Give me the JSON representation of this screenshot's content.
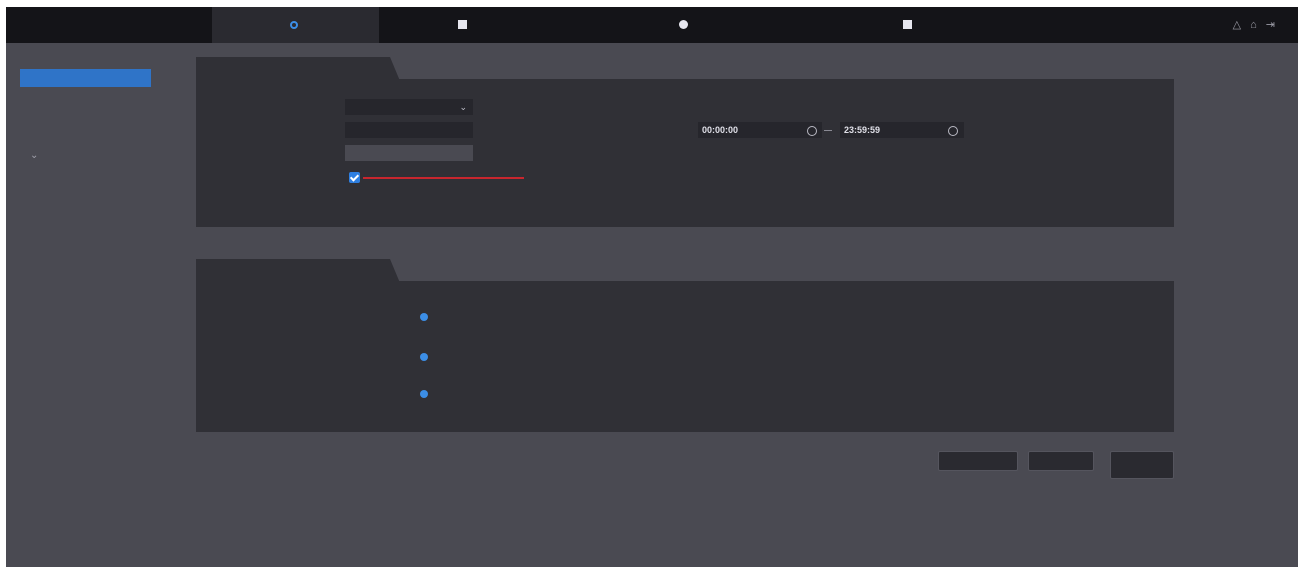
{
  "nav": {
    "home": "",
    "settings": "",
    "device_info": "",
    "network": "",
    "logs": "",
    "user": "",
    "icons": [
      "user-icon",
      "home-icon",
      "logout-icon"
    ]
  },
  "sidebar": {
    "items": [
      {
        "label": "",
        "active": true
      },
      {
        "label": "",
        "active": false
      },
      {
        "label": "",
        "active": false,
        "has_submenu": true
      },
      {
        "label": "",
        "active": false
      },
      {
        "label": "",
        "active": false
      },
      {
        "label": "",
        "active": false
      }
    ]
  },
  "device_props": {
    "tab": "",
    "device_type_label": "",
    "device_type_value": "",
    "door_number_label": "",
    "door_number_value": "",
    "max_label": "",
    "max_placeholder": "",
    "checkbox_label": "",
    "checkbox_label_2": "",
    "checkbox_checked": true,
    "schedule_label": "",
    "schedule_value": "",
    "time_range_label": "",
    "time_start": "00:00:00",
    "time_end": "23:59:59"
  },
  "events": {
    "tab": "",
    "rows": [
      {
        "label": "",
        "label_2": "",
        "off": "",
        "on": "",
        "value": "on"
      },
      {
        "label": "",
        "label_2": "",
        "off": "",
        "on": "",
        "value": "on"
      },
      {
        "label": "",
        "label_2": "",
        "off": "",
        "on": "",
        "value": "on"
      }
    ]
  },
  "buttons": {
    "refresh": "",
    "apply": "",
    "default_line1": "",
    "default_line2": ""
  },
  "colors": {
    "accent": "#3c8ee6",
    "sidebar_active": "#2f74c8",
    "warning": "#c8262e",
    "panel": "#303036",
    "background": "#4a4a52",
    "topbar": "#141418"
  }
}
